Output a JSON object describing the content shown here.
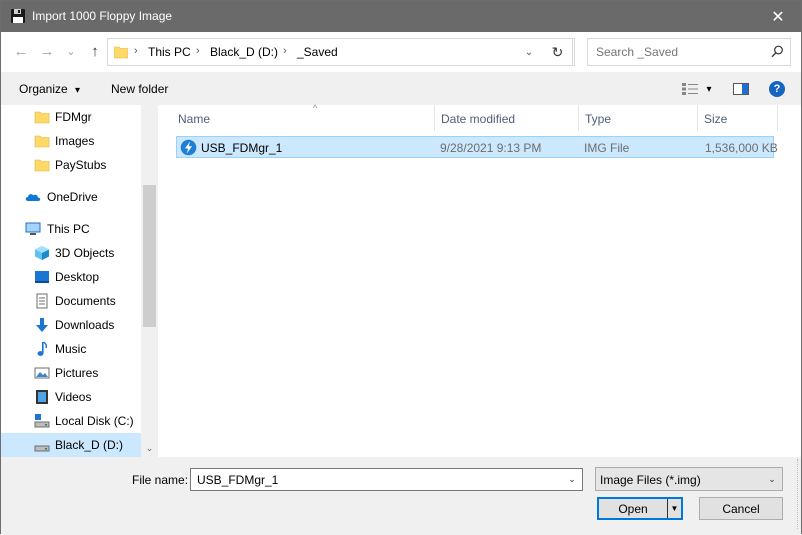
{
  "window": {
    "title": "Import 1000 Floppy Image",
    "close_glyph": "✕"
  },
  "address": {
    "back_glyph": "←",
    "forward_glyph": "→",
    "recent_glyph": "⌄",
    "up_glyph": "↑",
    "crumbs": [
      "This PC",
      "Black_D (D:)",
      "_Saved"
    ],
    "sep_glyph": "›",
    "refresh_glyph": "↻",
    "search_placeholder": "Search _Saved"
  },
  "toolbar": {
    "organize": "Organize",
    "new_folder": "New folder",
    "dropdown_glyph": "▾",
    "help_glyph": "?"
  },
  "nav": {
    "items": [
      {
        "label": "FDMgr",
        "icon": "folder-icon"
      },
      {
        "label": "Images",
        "icon": "folder-icon"
      },
      {
        "label": "PayStubs",
        "icon": "folder-icon"
      },
      {
        "label": "OneDrive",
        "icon": "cloud-icon"
      },
      {
        "label": "This PC",
        "icon": "computer-icon"
      },
      {
        "label": "3D Objects",
        "icon": "cube-icon"
      },
      {
        "label": "Desktop",
        "icon": "desktop-icon"
      },
      {
        "label": "Documents",
        "icon": "document-icon"
      },
      {
        "label": "Downloads",
        "icon": "download-icon"
      },
      {
        "label": "Music",
        "icon": "music-icon"
      },
      {
        "label": "Pictures",
        "icon": "pictures-icon"
      },
      {
        "label": "Videos",
        "icon": "video-icon"
      },
      {
        "label": "Local Disk (C:)",
        "icon": "drive-icon"
      },
      {
        "label": "Black_D (D:)",
        "icon": "drive-icon",
        "selected": true
      }
    ],
    "scroll_down_glyph": "⌄"
  },
  "files": {
    "columns": [
      "Name",
      "Date modified",
      "Type",
      "Size"
    ],
    "sort_glyph": "^",
    "rows": [
      {
        "name": "USB_FDMgr_1",
        "date": "9/28/2021 9:13 PM",
        "type": "IMG File",
        "size": "1,536,000 KB"
      }
    ]
  },
  "bottom": {
    "file_name_label": "File name:",
    "file_name_value": "USB_FDMgr_1",
    "file_type": "Image Files (*.img)",
    "open_label": "Open",
    "cancel_label": "Cancel",
    "dropdown_glyph": "⌄",
    "split_glyph": "▼"
  },
  "colors": {
    "titlebar": "#6a6a6a",
    "selection": "#cce8ff",
    "selection_border": "#99d1ff",
    "accent": "#0078d7",
    "folder": "#ffd968"
  }
}
